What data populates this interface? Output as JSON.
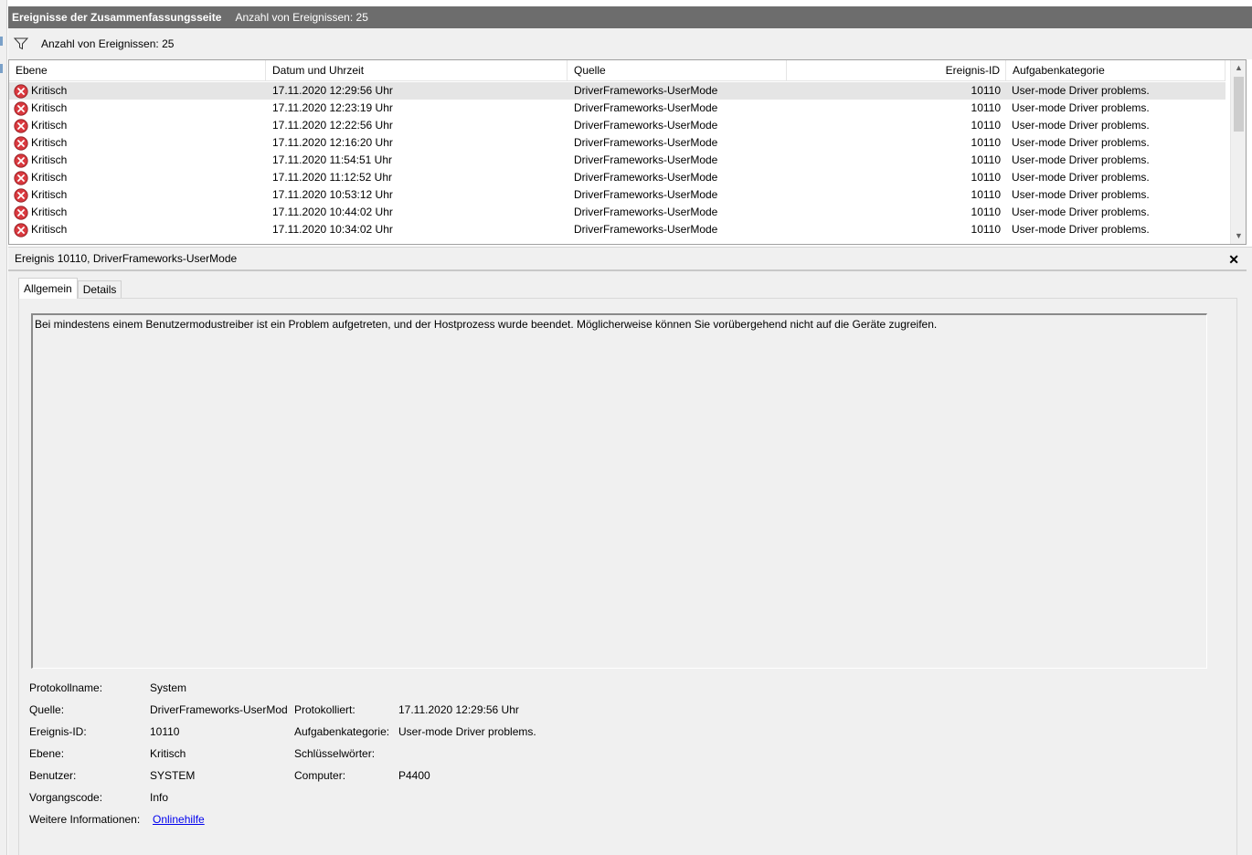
{
  "title_bar": {
    "title": "Ereignisse der Zusammenfassungsseite",
    "count": "Anzahl von Ereignissen: 25"
  },
  "filter_bar": {
    "icon": "filter-icon",
    "text": "Anzahl von Ereignissen: 25"
  },
  "event_list": {
    "columns": {
      "level": "Ebene",
      "date": "Datum und Uhrzeit",
      "source": "Quelle",
      "id": "Ereignis-ID",
      "category": "Aufgabenkategorie"
    },
    "rows": [
      {
        "level": "Kritisch",
        "date": "17.11.2020 12:29:56 Uhr",
        "source": "DriverFrameworks-UserMode",
        "id": "10110",
        "category": "User-mode Driver problems."
      },
      {
        "level": "Kritisch",
        "date": "17.11.2020 12:23:19 Uhr",
        "source": "DriverFrameworks-UserMode",
        "id": "10110",
        "category": "User-mode Driver problems."
      },
      {
        "level": "Kritisch",
        "date": "17.11.2020 12:22:56 Uhr",
        "source": "DriverFrameworks-UserMode",
        "id": "10110",
        "category": "User-mode Driver problems."
      },
      {
        "level": "Kritisch",
        "date": "17.11.2020 12:16:20 Uhr",
        "source": "DriverFrameworks-UserMode",
        "id": "10110",
        "category": "User-mode Driver problems."
      },
      {
        "level": "Kritisch",
        "date": "17.11.2020 11:54:51 Uhr",
        "source": "DriverFrameworks-UserMode",
        "id": "10110",
        "category": "User-mode Driver problems."
      },
      {
        "level": "Kritisch",
        "date": "17.11.2020 11:12:52 Uhr",
        "source": "DriverFrameworks-UserMode",
        "id": "10110",
        "category": "User-mode Driver problems."
      },
      {
        "level": "Kritisch",
        "date": "17.11.2020 10:53:12 Uhr",
        "source": "DriverFrameworks-UserMode",
        "id": "10110",
        "category": "User-mode Driver problems."
      },
      {
        "level": "Kritisch",
        "date": "17.11.2020 10:44:02 Uhr",
        "source": "DriverFrameworks-UserMode",
        "id": "10110",
        "category": "User-mode Driver problems."
      },
      {
        "level": "Kritisch",
        "date": "17.11.2020 10:34:02 Uhr",
        "source": "DriverFrameworks-UserMode",
        "id": "10110",
        "category": "User-mode Driver problems."
      }
    ],
    "colors": {
      "critical_icon": "#d9393f",
      "selected_row": "#e5e5e5"
    }
  },
  "detail": {
    "header": "Ereignis 10110, DriverFrameworks-UserMode",
    "close_label": "✕",
    "tabs": {
      "general": "Allgemein",
      "details": "Details"
    },
    "description": "Bei mindestens einem Benutzermodustreiber ist ein Problem aufgetreten, und der Hostprozess wurde beendet. Möglicherweise können Sie vorübergehend nicht auf die Geräte zugreifen.",
    "properties": {
      "log_name_label": "Protokollname:",
      "log_name": "System",
      "source_label": "Quelle:",
      "source": "DriverFrameworks-UserMod",
      "logged_label": "Protokolliert:",
      "logged": "17.11.2020 12:29:56 Uhr",
      "event_id_label": "Ereignis-ID:",
      "event_id": "10110",
      "task_category_label": "Aufgabenkategorie:",
      "task_category": "User-mode Driver problems.",
      "level_label": "Ebene:",
      "level": "Kritisch",
      "keywords_label": "Schlüsselwörter:",
      "user_label": "Benutzer:",
      "user": "SYSTEM",
      "computer_label": "Computer:",
      "computer": "P4400",
      "opcode_label": "Vorgangscode:",
      "opcode": "Info",
      "more_info_label": "Weitere Informationen:",
      "more_info_link": "Onlinehilfe"
    }
  }
}
